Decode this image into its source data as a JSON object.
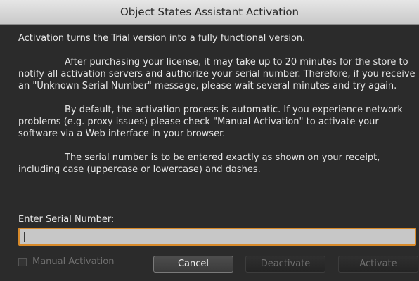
{
  "window": {
    "title": "Object States Assistant Activation"
  },
  "body": {
    "p1": "Activation turns the Trial version into a fully functional version.",
    "p2": "After purchasing your license, it may take up to 20 minutes for the store to notify all activation servers and authorize your serial number. Therefore, if you receive an \"Unknown Serial Number\" message, please wait several minutes and try again.",
    "p3": "By default, the activation process is automatic. If you experience network problems (e.g. proxy issues) please check \"Manual Activation\" to activate your software via a Web interface in your browser.",
    "p4": "The serial number is to be entered exactly as shown on your receipt, including case (uppercase or lowercase) and dashes."
  },
  "serial": {
    "label": "Enter Serial Number:",
    "value": "",
    "placeholder": ""
  },
  "manual": {
    "label": "Manual Activation",
    "checked": false
  },
  "buttons": {
    "cancel": "Cancel",
    "deactivate": "Deactivate",
    "activate": "Activate"
  },
  "colors": {
    "focus_ring": "#d88a2a",
    "window_bg": "#2b2b2b"
  }
}
